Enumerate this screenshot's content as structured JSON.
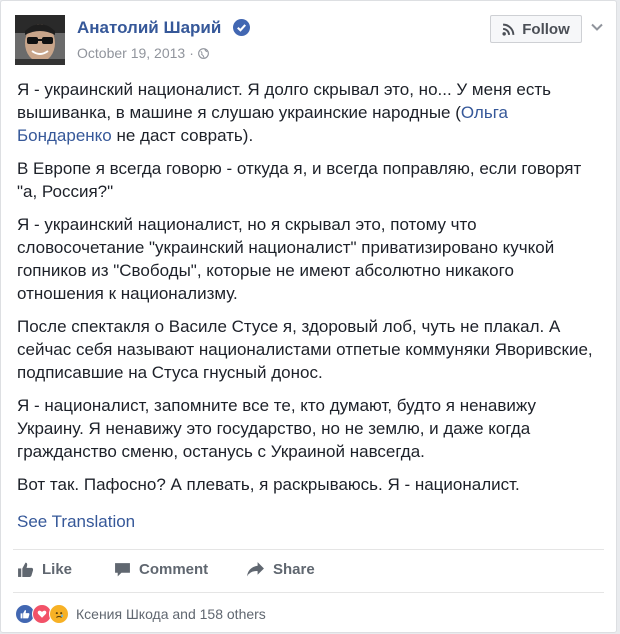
{
  "post": {
    "author": "Анатолий Шарий",
    "date": "October 19, 2013",
    "separator": "·",
    "follow_label": "Follow",
    "paragraphs": [
      {
        "text_before": "Я - украинский националист. Я долго скрывал это, но... У меня есть вышиванка, в машине я слушаю украинские народные (",
        "link": "Ольга Бондаренко",
        "text_after": " не даст соврать)."
      },
      {
        "text": "В Европе я всегда говорю - откуда я, и всегда поправляю, если говорят \"а, Россия?\""
      },
      {
        "text": "Я - украинский националист, но я скрывал это, потому что словосочетание \"украинский националист\" приватизировано кучкой гопников из \"Свободы\", которые не имеют абсолютно никакого отношения к национализму."
      },
      {
        "text": "После спектакля о Василе Стусе я, здоровый лоб, чуть не плакал. А сейчас себя называют националистами отпетые коммуняки Яворивские, подписавшие на Стуса гнусный донос."
      },
      {
        "text": "Я - националист, запомните все те, кто думают, будто я ненавижу Украину. Я ненавижу это государство, но не землю, и даже когда гражданство сменю, останусь с Украиной навсегда."
      },
      {
        "text": "Вот так. Пафосно? А плевать, я раскрываюсь. Я - националист."
      }
    ],
    "see_translation": "See Translation"
  },
  "actions": {
    "like": "Like",
    "comment": "Comment",
    "share": "Share"
  },
  "reactions": {
    "summary": "Ксения Шкода and 158 others",
    "types": [
      "like-icon",
      "love-icon",
      "sad-icon"
    ]
  },
  "colors": {
    "link": "#365899",
    "text": "#1d2129",
    "muted": "#90949c",
    "like_blue": "#4267b2",
    "love_red": "#f25268",
    "sad_yellow": "#f7b125"
  }
}
